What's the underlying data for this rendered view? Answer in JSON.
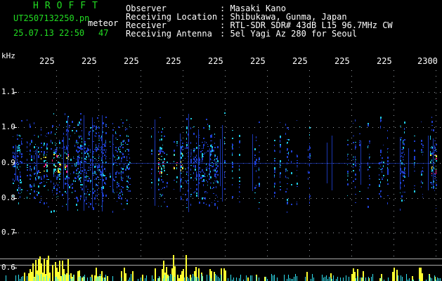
{
  "header": {
    "app_title": "HROFFT",
    "filename": "UT2507132250.pn",
    "meteor_label": "meteor",
    "timestamp": "25.07.13 22:50",
    "meteor_count": "47",
    "field_labels": [
      "Observer",
      "Receiving Location",
      "Receiver",
      "Receiving Antenna"
    ],
    "field_values": [
      ": Masaki Kano",
      ": Shibukawa, Gunma, Japan",
      ": RTL-SDR SDR# 43dB L15 96.7MHz CW",
      ": 5el Yagi Az 280 for Seoul"
    ]
  },
  "axis": {
    "unit_label": "kHz",
    "y_ticks": [
      "1.1",
      "1.0",
      "0.9",
      "0.8",
      "0.7",
      "0.6"
    ],
    "x_ticks": [
      "225",
      "225",
      "225",
      "225",
      "225",
      "225",
      "225",
      "225",
      "225",
      "2300"
    ]
  },
  "colors": {
    "background": "#000000",
    "text": "#ffffff",
    "title_green": "#22dd22",
    "grid_dots": "#9aa0a6",
    "signal_low": "#1f3fd0",
    "signal_mid": "#20c8e0",
    "signal_high": "#f0f040",
    "signal_peak": "#ff2080",
    "echo_bars": "#ffff30",
    "echo_baseline": "#30e0f0"
  }
}
